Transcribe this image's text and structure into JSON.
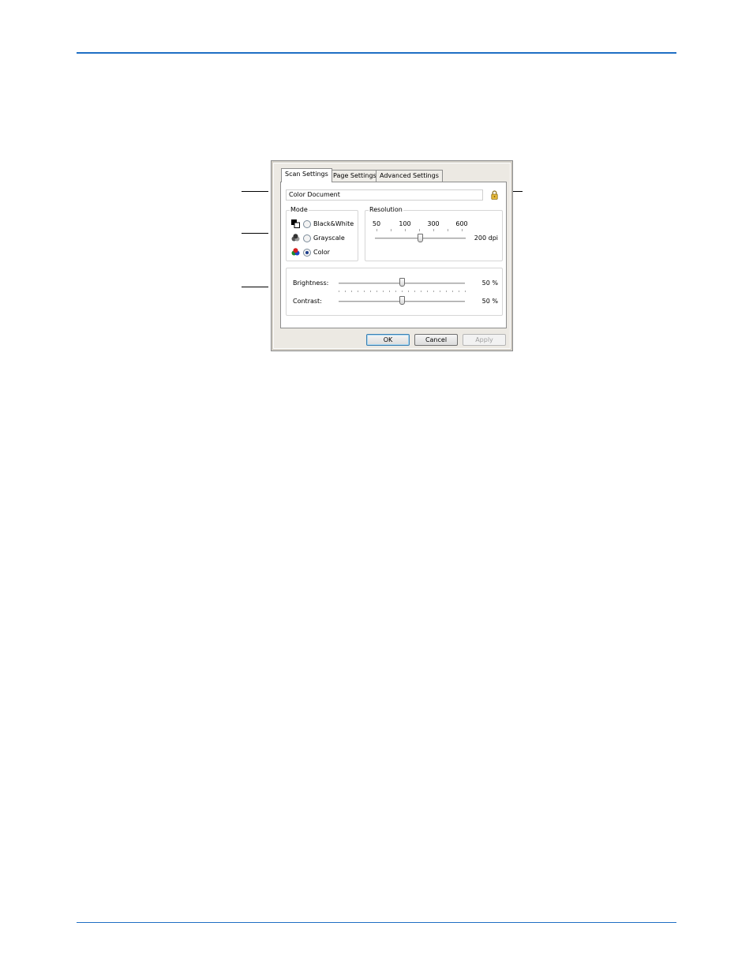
{
  "dialog": {
    "tabs": [
      {
        "label": "Scan Settings",
        "active": true
      },
      {
        "label": "Page Settings",
        "active": false
      },
      {
        "label": "Advanced Settings",
        "active": false
      }
    ],
    "preset_name": "Color Document",
    "lock_icon": "padlock-icon",
    "mode": {
      "title": "Mode",
      "options": [
        {
          "label": "Black&White",
          "icon": "black-white-mode-icon",
          "selected": false
        },
        {
          "label": "Grayscale",
          "icon": "grayscale-mode-icon",
          "selected": false
        },
        {
          "label": "Color",
          "icon": "color-mode-icon",
          "selected": true
        }
      ]
    },
    "resolution": {
      "title": "Resolution",
      "ticks": [
        "50",
        "100",
        "300",
        "600"
      ],
      "value": "200 dpi",
      "position": 0.5
    },
    "brightness": {
      "label": "Brightness:",
      "value": "50 %",
      "position": 0.5
    },
    "contrast": {
      "label": "Contrast:",
      "value": "50 %",
      "position": 0.5
    },
    "buttons": {
      "ok": "OK",
      "cancel": "Cancel",
      "apply": "Apply"
    }
  },
  "colors": {
    "rule": "#1f6fc4",
    "dialog_frame": "#d4d0c8",
    "default_button_border": "#3c7fb1"
  }
}
